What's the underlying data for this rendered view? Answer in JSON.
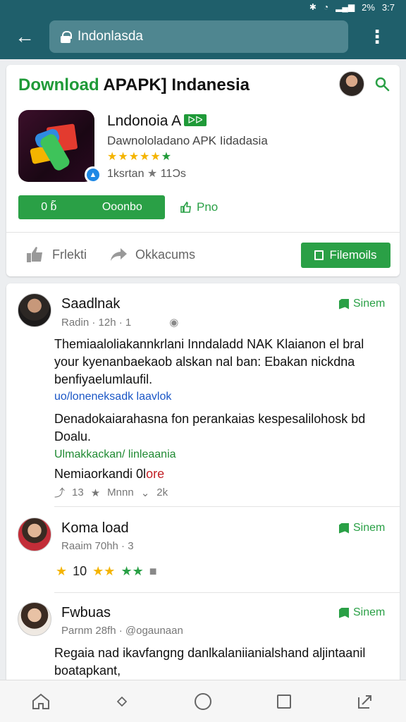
{
  "status_bar": {
    "bluetooth_icon": "bluetooth-icon",
    "wifi_icon": "wifi-icon",
    "signal": "2%",
    "time": "3:7"
  },
  "browser": {
    "url": "Indonlasda",
    "back_icon": "back-arrow-icon",
    "menu_icon": "more-vert-icon"
  },
  "site": {
    "title_green": "Download",
    "title_rest": " APAPK] Indanesia",
    "avatar_icon": "user-avatar",
    "search_icon": "search-icon",
    "brand_color": "#2aa046"
  },
  "app": {
    "name": "Lndonoia A",
    "name_badge": "ᐅᐅ",
    "developer": "Dawnololadano APK Iidadasia",
    "stars": "★★★★★",
    "last_star": "★",
    "meta_left": "1ksrtan",
    "meta_right": "11Ɔs",
    "install_left": "0 ɓ̃",
    "install_right": "Ooonbo",
    "pin_label": "Pno",
    "like_label": "Frlekti",
    "share_label": "Okkacums",
    "follow_label": "Filemoils"
  },
  "comments": [
    {
      "name": "Saadlnak",
      "meta": "Radin · 12h · 1",
      "follow": "Sinem",
      "body": "Themiaaloliakannkrlani Inndaladd NAK Klaianon el bral your kyenanbaekaob alskan nal ban: Ebakan nickdna benfiyaelumlaufil.",
      "link1": "uo/loneneksadk laavlok",
      "body2": "Denadokaiarahasna fon perankaias kespesalilohosk bd Doalu.",
      "link2": "Ulmakkackan/ linleaania",
      "note": "Nemiaorkandi 0l",
      "note_red": "ore",
      "reply_count": "13",
      "share_label": "Mnnn",
      "views": "2k"
    },
    {
      "name": "Koma load",
      "meta": "Raaim 70hh · 3",
      "follow": "Sinem",
      "rating_text": "10"
    },
    {
      "name": "Fwbuas",
      "meta": "Parnm 28fh · @ogaunaan",
      "follow": "Sinem",
      "body": "Regaia nad ikavfangng danlkalaniianialshand aljintaanil boatapkant,"
    }
  ],
  "bottom_nav": [
    "home-icon",
    "diamond-icon",
    "circle-icon",
    "square-icon",
    "share-icon"
  ]
}
